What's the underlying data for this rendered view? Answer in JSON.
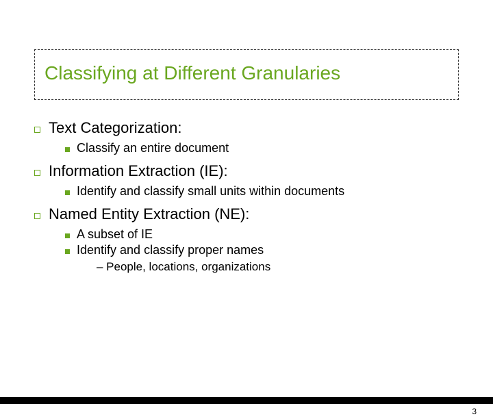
{
  "title": "Classifying at Different Granularies",
  "items": [
    {
      "label": "Text Categorization:",
      "sub": [
        {
          "label": "Classify an entire document"
        }
      ]
    },
    {
      "label": "Information Extraction (IE):",
      "sub": [
        {
          "label": "Identify and classify  small units within documents"
        }
      ]
    },
    {
      "label": "Named Entity Extraction (NE):",
      "sub": [
        {
          "label": "A subset of IE"
        },
        {
          "label": "Identify and classify proper names",
          "subsub": [
            "– People, locations, organizations"
          ]
        }
      ]
    }
  ],
  "page_number": "3"
}
